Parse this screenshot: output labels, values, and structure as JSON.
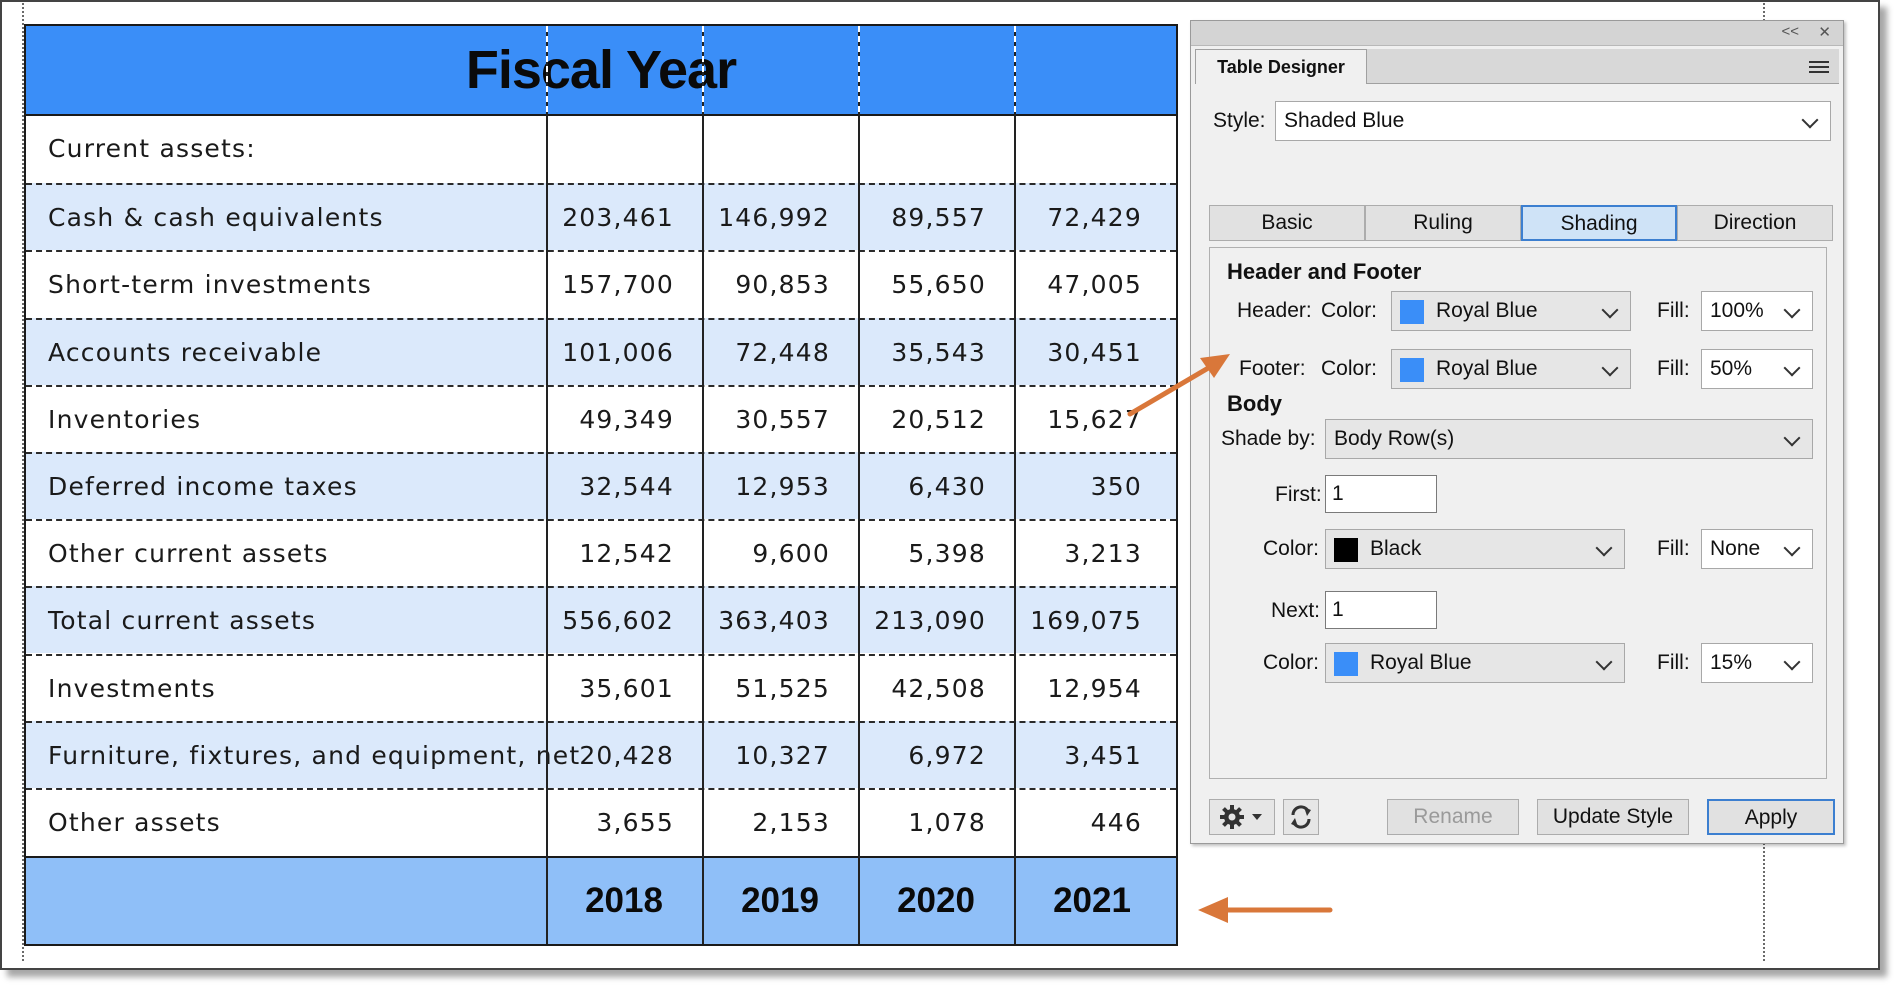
{
  "table": {
    "header_title": "Fiscal Year",
    "rows": [
      {
        "label": "Current assets:",
        "values": [
          "",
          "",
          "",
          ""
        ]
      },
      {
        "label": "Cash & cash equivalents",
        "values": [
          "203,461",
          "146,992",
          "89,557",
          "72,429"
        ]
      },
      {
        "label": "Short-term investments",
        "values": [
          "157,700",
          "90,853",
          "55,650",
          "47,005"
        ]
      },
      {
        "label": "Accounts receivable",
        "values": [
          "101,006",
          "72,448",
          "35,543",
          "30,451"
        ]
      },
      {
        "label": "Inventories",
        "values": [
          "49,349",
          "30,557",
          "20,512",
          "15,627"
        ]
      },
      {
        "label": "Deferred income taxes",
        "values": [
          "32,544",
          "12,953",
          "6,430",
          "350"
        ]
      },
      {
        "label": "Other current assets",
        "values": [
          "12,542",
          "9,600",
          "5,398",
          "3,213"
        ]
      },
      {
        "label": "Total current assets",
        "values": [
          "556,602",
          "363,403",
          "213,090",
          "169,075"
        ]
      },
      {
        "label": "Investments",
        "values": [
          "35,601",
          "51,525",
          "42,508",
          "12,954"
        ]
      },
      {
        "label": "Furniture, fixtures, and equipment, net",
        "values": [
          "20,428",
          "10,327",
          "6,972",
          "3,451"
        ]
      },
      {
        "label": "Other assets",
        "values": [
          "3,655",
          "2,153",
          "1,078",
          "446"
        ]
      }
    ],
    "footer_years": [
      "2018",
      "2019",
      "2020",
      "2021"
    ],
    "colors": {
      "header": "#3a8ef8",
      "footer": "#8fbff8",
      "shaded_row": "#dbe9fb"
    }
  },
  "panel": {
    "tab_title": "Table Designer",
    "titlebar_collapse": "<<",
    "titlebar_close": "✕",
    "style_label": "Style:",
    "style_value": "Shaded Blue",
    "tabs": [
      "Basic",
      "Ruling",
      "Shading",
      "Direction"
    ],
    "active_tab": "Shading",
    "header_footer_heading": "Header and Footer",
    "header_label": "Header:",
    "footer_label": "Footer:",
    "color_label": "Color:",
    "fill_label": "Fill:",
    "header_color": "Royal Blue",
    "header_fill": "100%",
    "footer_color": "Royal Blue",
    "footer_fill": "50%",
    "body_heading": "Body",
    "shade_by_label": "Shade by:",
    "shade_by_value": "Body Row(s)",
    "first_label": "First:",
    "first_value": "1",
    "first_color": "Black",
    "first_fill": "None",
    "next_label": "Next:",
    "next_value": "1",
    "next_color": "Royal Blue",
    "next_fill": "15%",
    "buttons": {
      "rename": "Rename",
      "update_style": "Update Style",
      "apply": "Apply"
    },
    "swatch_colors": {
      "royal_blue": "#3a8ef8",
      "black": "#000000"
    }
  },
  "annotations": {
    "arrow_color": "#d9773a"
  }
}
